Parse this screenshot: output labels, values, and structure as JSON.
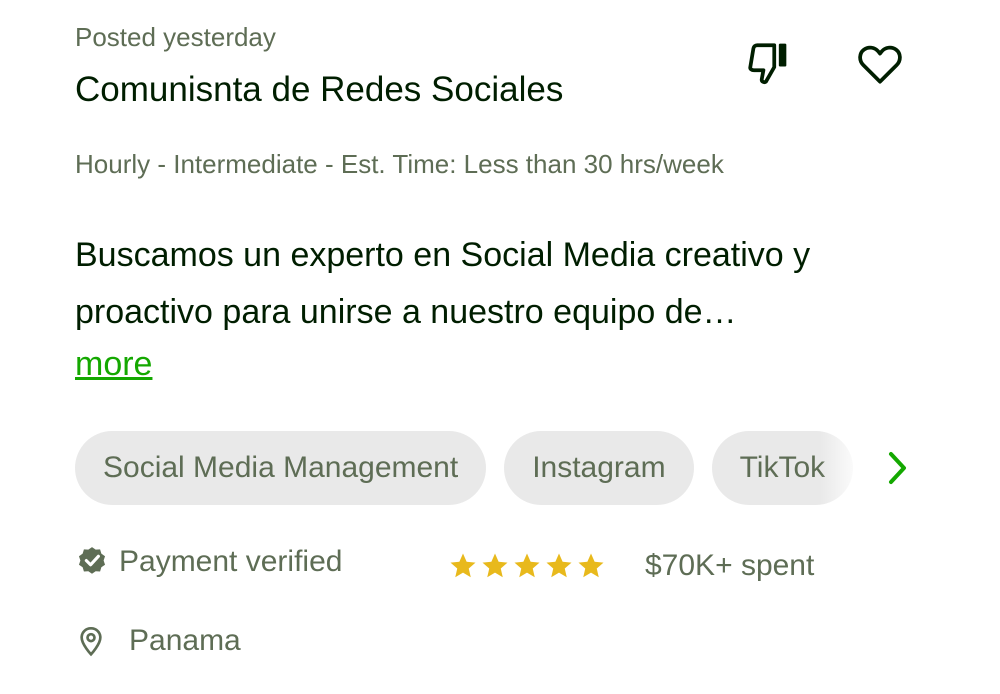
{
  "job": {
    "posted": "Posted yesterday",
    "title": "Comunisnta de Redes Sociales",
    "meta": "Hourly - Intermediate - Est. Time: Less than 30 hrs/week",
    "description": "Buscamos un experto en Social Media creativo y proactivo para unirse a nuestro equipo de…",
    "more_label": "more",
    "skills": [
      "Social Media Management",
      "Instagram",
      "TikTok"
    ]
  },
  "client": {
    "payment_status": "Payment verified",
    "rating": 5,
    "spent_amount": "$70K+",
    "spent_label": "spent",
    "location": "Panama"
  },
  "icons": {
    "dislike": "thumbs-down-icon",
    "save": "heart-icon",
    "verified": "verified-badge-icon",
    "location": "location-pin-icon",
    "next": "chevron-right-icon",
    "star": "star-icon"
  },
  "colors": {
    "accent_green": "#14a800",
    "text_primary": "#001e00",
    "text_secondary": "#5e6d55",
    "chip_bg": "#e9e9e9",
    "star_gold": "#e8b91c"
  }
}
